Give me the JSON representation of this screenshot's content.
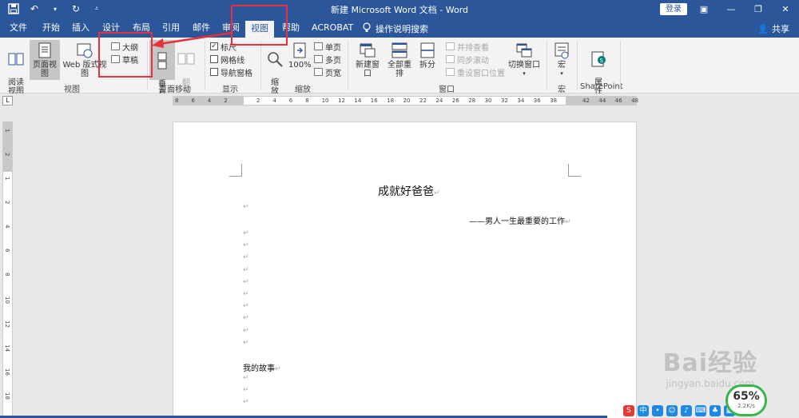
{
  "window": {
    "title": "新建 Microsoft Word 文档  -  Word",
    "login": "登录",
    "share": "共享"
  },
  "tabs": [
    "文件",
    "开始",
    "插入",
    "设计",
    "布局",
    "引用",
    "邮件",
    "审阅",
    "视图",
    "帮助",
    "ACROBAT"
  ],
  "active_tab": "视图",
  "tell_me": "操作说明搜索",
  "ribbon": {
    "views": {
      "read_mode": "阅读\n视图",
      "print_layout": "页面视图",
      "web_layout": "Web 版式视图",
      "outline": "大纲",
      "draft": "草稿",
      "group_label": "视图"
    },
    "page_movement": {
      "vertical": "垂\n直",
      "side_to_side": "翻\n页",
      "group_label": "页面移动"
    },
    "show": {
      "ruler": "标尺",
      "ruler_checked": true,
      "gridlines": "网格线",
      "nav_pane": "导航窗格",
      "group_label": "显示"
    },
    "zoom": {
      "zoom": "缩\n放",
      "hundred": "100%",
      "one_page": "单页",
      "multi_page": "多页",
      "page_width": "页宽",
      "group_label": "缩放"
    },
    "window": {
      "new_window": "新建窗口",
      "arrange_all": "全部重排",
      "split": "拆分",
      "side_by_side": "并排查看",
      "sync_scroll": "同步滚动",
      "reset_pos": "重设窗口位置",
      "switch_windows": "切换窗口",
      "group_label": "窗口"
    },
    "macros": {
      "macros": "宏",
      "group_label": "宏"
    },
    "sharepoint": {
      "properties": "属\n性",
      "group_label": "SharePoint"
    }
  },
  "ruler_ticks": [
    "8",
    "6",
    "4",
    "2",
    "",
    "2",
    "4",
    "6",
    "8",
    "10",
    "12",
    "14",
    "16",
    "18",
    "20",
    "22",
    "24",
    "26",
    "28",
    "30",
    "32",
    "34",
    "36",
    "38",
    "",
    "42",
    "44",
    "46",
    "48"
  ],
  "vertical_ruler_ticks": [
    "1",
    "2",
    "1",
    "2",
    "4",
    "6",
    "8",
    "10",
    "12",
    "14",
    "16",
    "18"
  ],
  "document": {
    "title": "成就好爸爸",
    "subtitle": "——男人一生最重要的工作",
    "heading": "我的故事",
    "pilcrow": "↵"
  },
  "watermark": {
    "brand": "Bai经验",
    "url": "jingyan.baidu.com"
  },
  "speed": {
    "percent": "65%",
    "rate": "2.2K/s"
  }
}
